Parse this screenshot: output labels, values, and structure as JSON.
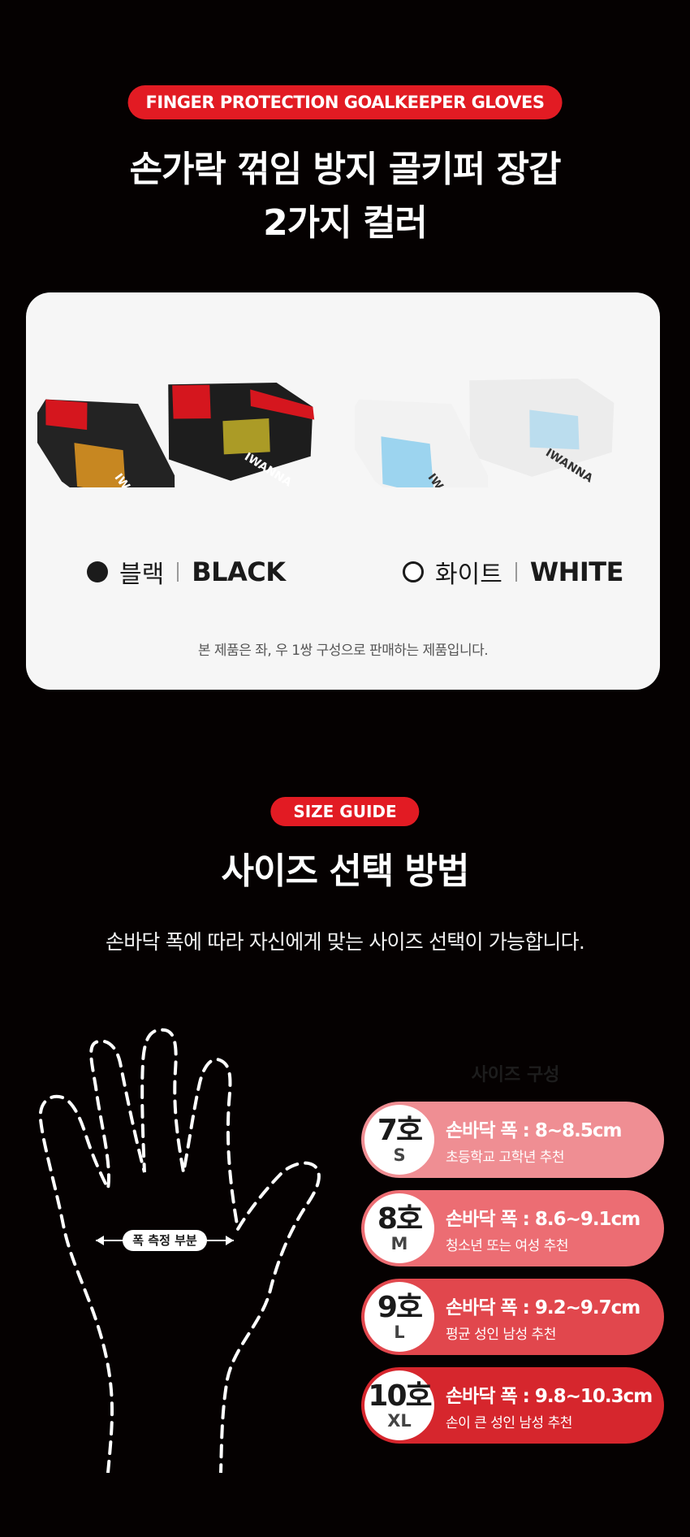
{
  "color_section": {
    "badge": "FINGER PROTECTION GOALKEEPER GLOVES",
    "title_line1": "손가락 꺾임 방지 골키퍼 장갑",
    "title_line2": "2가지 컬러",
    "colors": [
      {
        "kr": "블랙",
        "en": "BLACK",
        "swatch": "#1b1b1b"
      },
      {
        "kr": "화이트",
        "en": "WHITE",
        "swatch": "#ffffff"
      }
    ],
    "note": "본 제품은 좌, 우 1쌍 구성으로 판매하는 제품입니다."
  },
  "size_section": {
    "badge": "SIZE GUIDE",
    "title": "사이즈 선택 방법",
    "subtitle": "손바닥 폭에 따라 자신에게 맞는 사이즈 선택이 가능합니다.",
    "table_heading": "사이즈 구성",
    "measure_label": "폭 측정 부분",
    "sizes": [
      {
        "number": "7호",
        "letter": "S",
        "width": "손바닥 폭 : 8~8.5cm",
        "recommend": "초등학교 고학년 추천",
        "color": "#ef8e93"
      },
      {
        "number": "8호",
        "letter": "M",
        "width": "손바닥 폭 : 8.6~9.1cm",
        "recommend": "청소년 또는 여성 추천",
        "color": "#ec6d73"
      },
      {
        "number": "9호",
        "letter": "L",
        "width": "손바닥 폭 : 9.2~9.7cm",
        "recommend": "평균 성인 남성 추천",
        "color": "#e1474d"
      },
      {
        "number": "10호",
        "letter": "XL",
        "width": "손바닥 폭 : 9.8~10.3cm",
        "recommend": "손이 큰 성인 남성 추천",
        "color": "#d6262d"
      }
    ]
  }
}
